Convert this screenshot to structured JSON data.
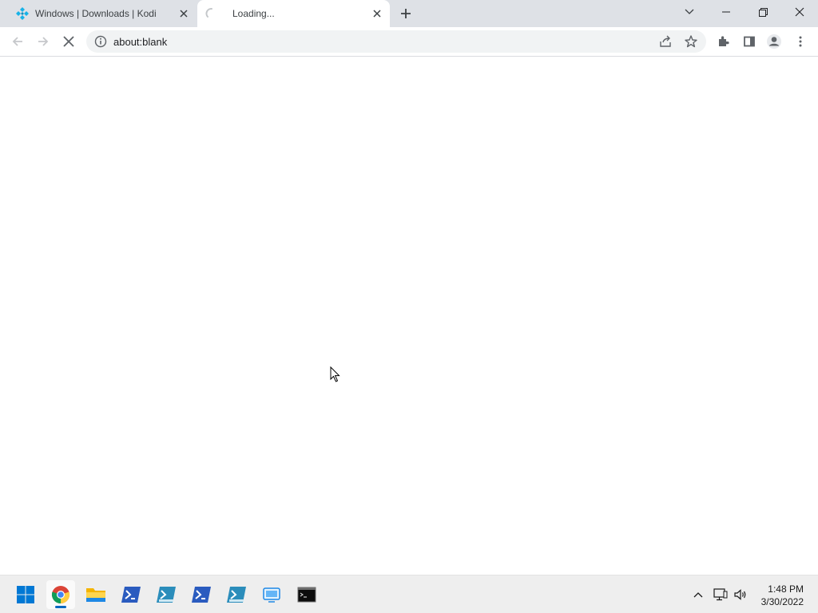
{
  "browser": {
    "tabs": [
      {
        "title": "Windows | Downloads | Kodi",
        "favicon": "kodi-icon",
        "active": false
      },
      {
        "title": "Loading...",
        "favicon": "loading-spinner-icon",
        "active": true
      }
    ],
    "address_bar": {
      "url": "about:blank"
    }
  },
  "taskbar": {
    "apps": [
      "start-icon",
      "chrome-icon",
      "file-explorer-icon",
      "powershell-icon",
      "powershell-ise-icon",
      "powershell-icon",
      "powershell-ise-icon",
      "remote-desktop-icon",
      "command-prompt-icon"
    ],
    "active_app": "chrome-icon",
    "clock": {
      "time": "1:48 PM",
      "date": "3/30/2022"
    }
  },
  "colors": {
    "tabstrip_bg": "#dee1e6",
    "taskbar_bg": "#eeeeee",
    "accent": "#0067c0",
    "kodi_blue": "#17b2e7"
  }
}
